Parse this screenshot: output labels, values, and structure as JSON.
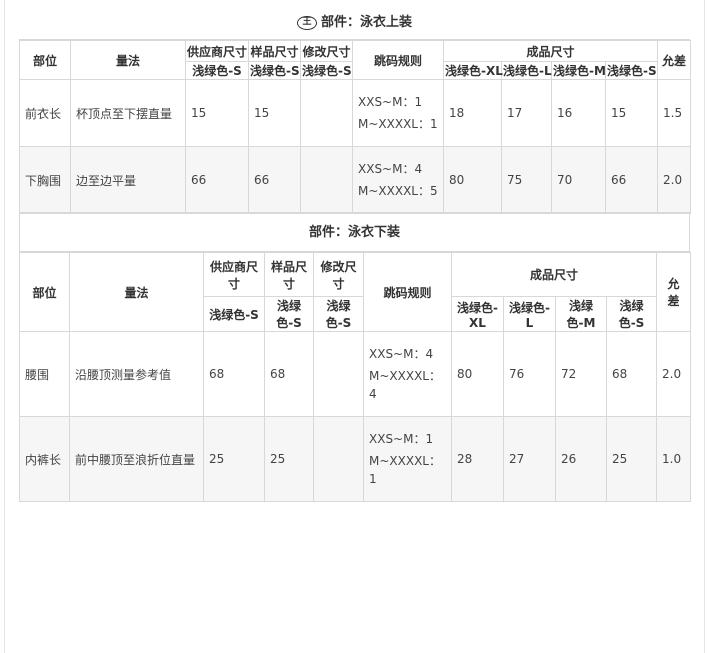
{
  "top": {
    "section_title": "部件：泳衣上装",
    "logo_glyph": "王",
    "headers": {
      "part": "部位",
      "method": "量法",
      "supplier": "供应商尺寸",
      "sample": "样品尺寸",
      "modified": "修改尺寸",
      "rule": "跳码规则",
      "finished": "成品尺寸",
      "tolerance": "允差"
    },
    "sub_headers": {
      "supplier": "浅绿色-S",
      "sample": "浅绿色-S",
      "modified": "浅绿色-S",
      "xl": "浅绿色-XL",
      "l": "浅绿色-L",
      "m": "浅绿色-M",
      "s": "浅绿色-S"
    },
    "rows": [
      {
        "part": "前衣长",
        "method": "杯顶点至下摆直量",
        "supplier": "15",
        "sample": "15",
        "modified": "",
        "rule1": "XXS~M：1",
        "rule2": "M~XXXXL：1",
        "xl": "18",
        "l": "17",
        "m": "16",
        "s": "15",
        "tolerance": "1.5"
      },
      {
        "part": "下胸围",
        "method": "边至边平量",
        "supplier": "66",
        "sample": "66",
        "modified": "",
        "rule1": "XXS~M：4",
        "rule2": "M~XXXXL：5",
        "xl": "80",
        "l": "75",
        "m": "70",
        "s": "66",
        "tolerance": "2.0"
      }
    ]
  },
  "bottom": {
    "section_title": "部件：泳衣下装",
    "headers": {
      "part": "部位",
      "method": "量法",
      "supplier": "供应商尺寸",
      "sample": "样品尺寸",
      "modified": "修改尺寸",
      "rule": "跳码规则",
      "finished": "成品尺寸",
      "tolerance": "允差"
    },
    "sub_headers": {
      "supplier": "浅绿色-S",
      "sample": "浅绿色-S",
      "modified": "浅绿色-S",
      "xl": "浅绿色-XL",
      "l": "浅绿色-L",
      "m": "浅绿色-M",
      "s": "浅绿色-S"
    },
    "rows": [
      {
        "part": "腰围",
        "method": "沿腰顶测量参考值",
        "supplier": "68",
        "sample": "68",
        "modified": "",
        "rule1": "XXS~M：4",
        "rule2": "M~XXXXL：4",
        "xl": "80",
        "l": "76",
        "m": "72",
        "s": "68",
        "tolerance": "2.0"
      },
      {
        "part": "内裤长",
        "method": "前中腰顶至浪折位直量",
        "supplier": "25",
        "sample": "25",
        "modified": "",
        "rule1": "XXS~M：1",
        "rule2": "M~XXXXL：1",
        "xl": "28",
        "l": "27",
        "m": "26",
        "s": "25",
        "tolerance": "1.0"
      }
    ]
  }
}
